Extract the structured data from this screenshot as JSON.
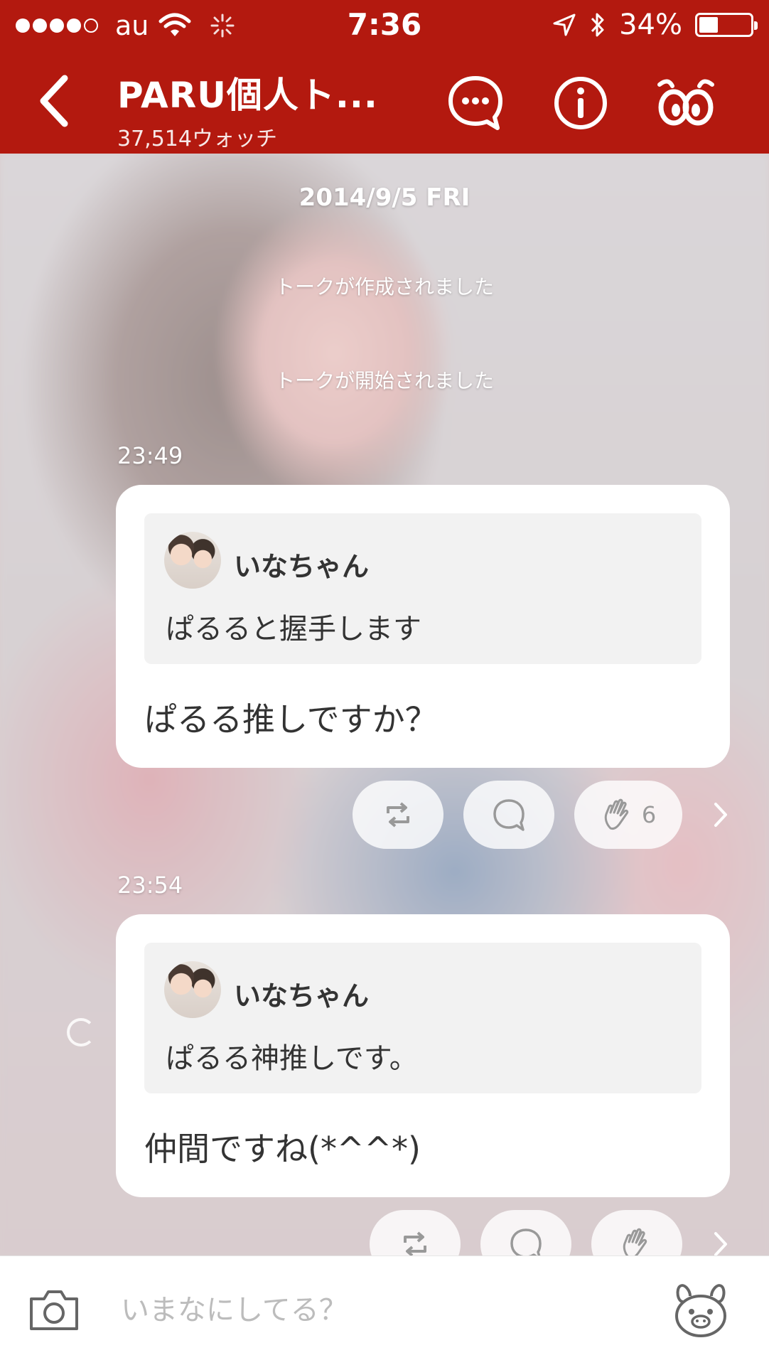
{
  "status_bar": {
    "carrier": "au",
    "time": "7:36",
    "battery": "34%",
    "battery_level": 0.34,
    "signal_bars_filled": 4,
    "signal_bars_total": 5
  },
  "header": {
    "title": "PARU個人ト...",
    "watch_count": "37,514ウォッチ",
    "icons": [
      "back-icon",
      "chat-icon",
      "info-icon",
      "watch-icon"
    ],
    "accent_color": "#b3190f"
  },
  "talk": {
    "date": "2014/9/5 FRI",
    "system_messages": [
      "トークが作成されました",
      "トークが開始されました"
    ],
    "posts": [
      {
        "time": "23:49",
        "quote_author": "いなちゃん",
        "quote_text": "ぱるると握手します",
        "message": "ぱるる推しですか？",
        "clap_count": "6"
      },
      {
        "time": "23:54",
        "quote_author": "いなちゃん",
        "quote_text": "ぱるる神推しです。",
        "message": "仲間ですね(*^^*)",
        "clap_count": ""
      }
    ]
  },
  "composer": {
    "placeholder": "いまなにしてる？",
    "icons": [
      "camera-icon",
      "stamp-icon"
    ]
  }
}
